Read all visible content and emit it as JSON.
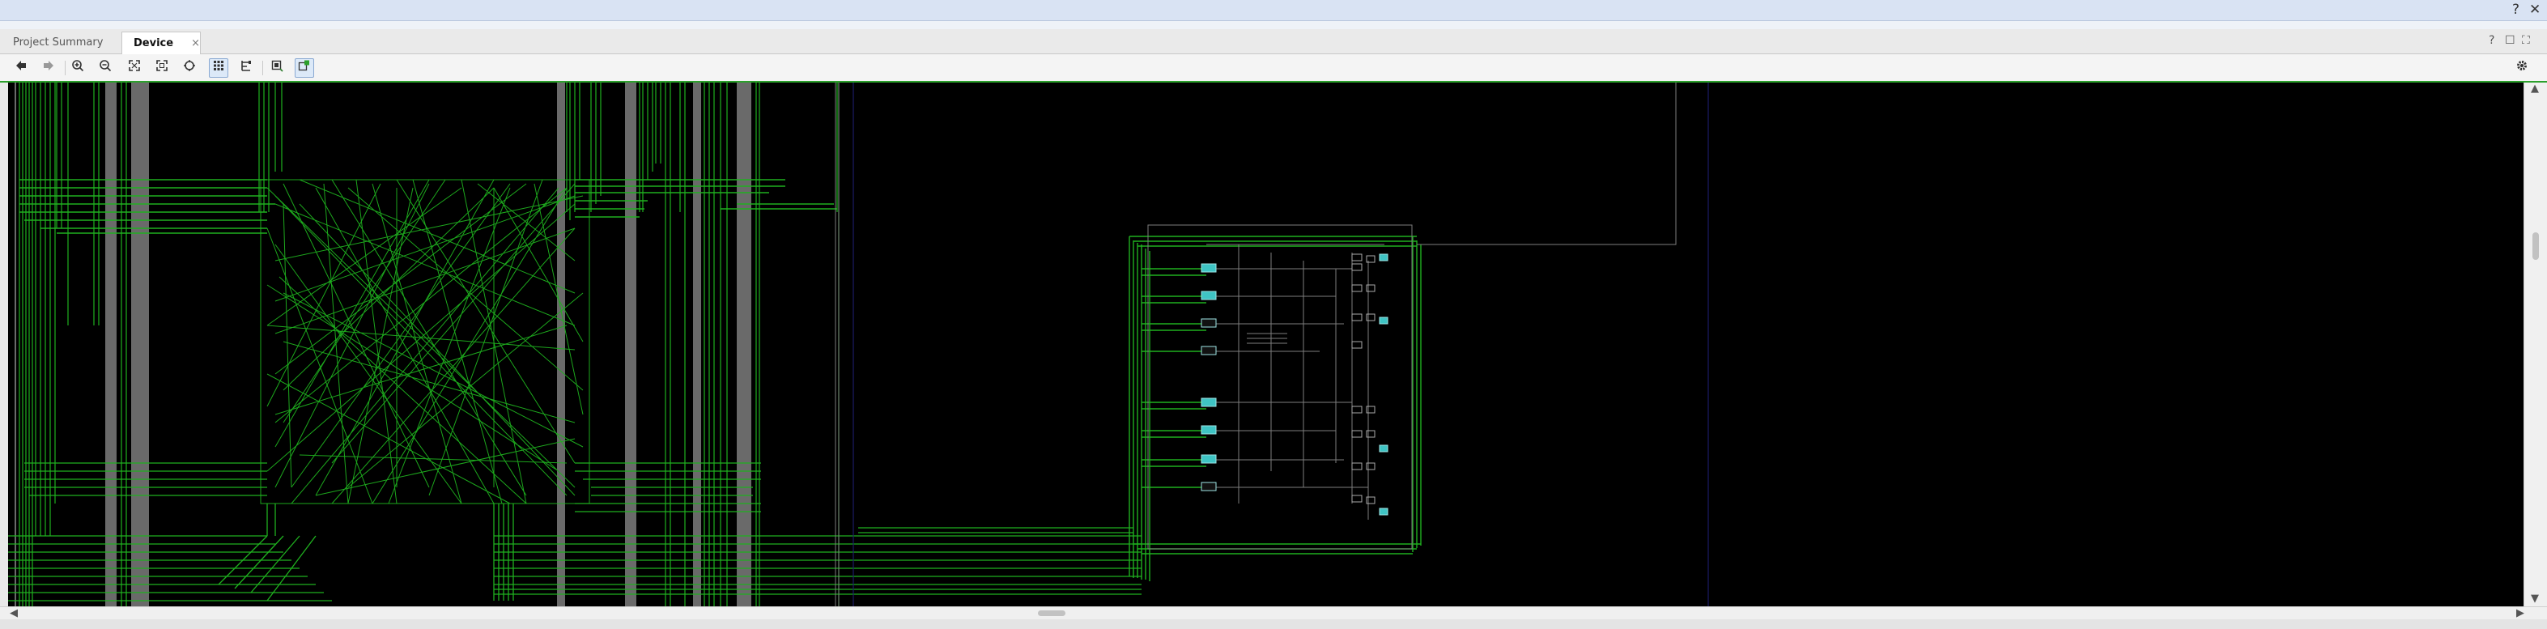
{
  "tabs": [
    {
      "label": "Project Summary",
      "close": "×"
    },
    {
      "label": "Device",
      "close": "×"
    }
  ],
  "window_controls": {
    "help": "?",
    "close": "✕",
    "panel_help": "?",
    "restore": "☐",
    "maximize": "⛶"
  },
  "toolbar": {
    "icons": [
      "back-icon",
      "forward-icon",
      "zoom-in-icon",
      "zoom-out-icon",
      "zoom-fit-icon",
      "zoom-area-icon",
      "auto-fit-icon",
      "routing-resources-icon",
      "show-nets-icon",
      "pin-icon",
      "select-icon",
      "draw-pblock-icon"
    ],
    "settings_icon": "gear-icon"
  },
  "colors": {
    "route": "#1fb01f",
    "background": "#000000",
    "grey_route": "#6f6f6f",
    "cell": "#40c8c8"
  }
}
